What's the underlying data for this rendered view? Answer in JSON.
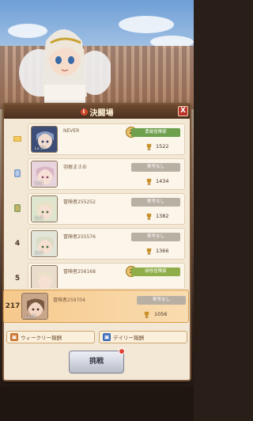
{
  "header": {
    "title": "決闘場",
    "close_label": "X"
  },
  "colors": {
    "accent_green": "#6ea04e",
    "panel_bg": "#f3e8d6",
    "header_brown": "#5a3c27"
  },
  "rows": [
    {
      "rank_icon": "crown-icon",
      "rank": "",
      "name": "NEVER",
      "level": "Lv.55",
      "tier": "2",
      "title": "勇敢冒険家",
      "title_style": "green",
      "score": "1522"
    },
    {
      "rank_icon": "silver-badge-icon",
      "rank": "",
      "name": "羽根まさお",
      "level": "Lv.9",
      "tier": "",
      "title": "称号なし",
      "title_style": "grey",
      "score": "1434"
    },
    {
      "rank_icon": "bronze-badge-icon",
      "rank": "",
      "name": "冒険者255252",
      "level": "Lv.3",
      "tier": "",
      "title": "称号なし",
      "title_style": "grey",
      "score": "1382"
    },
    {
      "rank_icon": "",
      "rank": "4",
      "name": "冒険者255576",
      "level": "Lv.3",
      "tier": "",
      "title": "称号なし",
      "title_style": "grey",
      "score": "1366"
    },
    {
      "rank_icon": "",
      "rank": "5",
      "name": "冒険者256168",
      "level": "Lv.3",
      "tier": "1",
      "title": "研修冒険家",
      "title_style": "gold",
      "score": ""
    }
  ],
  "my_row": {
    "rank": "217",
    "name": "冒険者259704",
    "level": "Lv.16",
    "title": "称号なし",
    "score": "1056"
  },
  "rewards": {
    "weekly": "ウィークリー報酬",
    "daily": "デイリー報酬"
  },
  "challenge_label": "挑戦"
}
